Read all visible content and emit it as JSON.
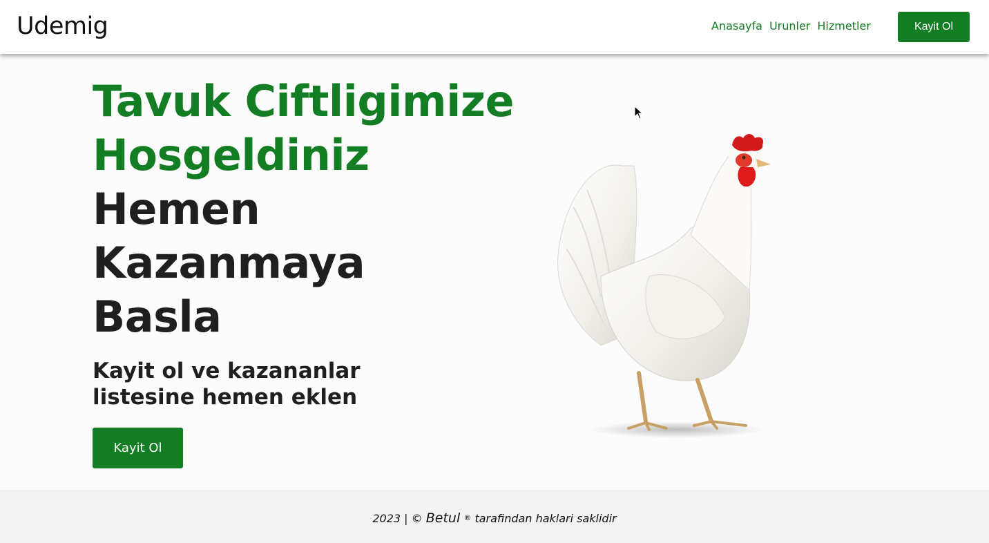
{
  "navbar": {
    "brand": "Udemig",
    "links": [
      "Anasayfa",
      "Urunler",
      "Hizmetler"
    ],
    "cta_label": "Kayit Ol"
  },
  "hero": {
    "headline_green": [
      "Tavuk Ciftligimize",
      "Hosgeldiniz"
    ],
    "headline_dark": [
      "Hemen",
      "Kazanmaya",
      "Basla"
    ],
    "subheadline": "Kayit ol ve kazananlar listesine hemen eklen",
    "cta_label": "Kayit Ol",
    "image": "white-hen-photo"
  },
  "footer": {
    "prefix": "2023 | ©",
    "author": "Betul",
    "registered": "®",
    "suffix": "tarafindan haklari saklidir"
  },
  "colors": {
    "accent": "#127d23",
    "text_dark": "#1f1f1f",
    "footer_bg": "#f3f3f3"
  }
}
